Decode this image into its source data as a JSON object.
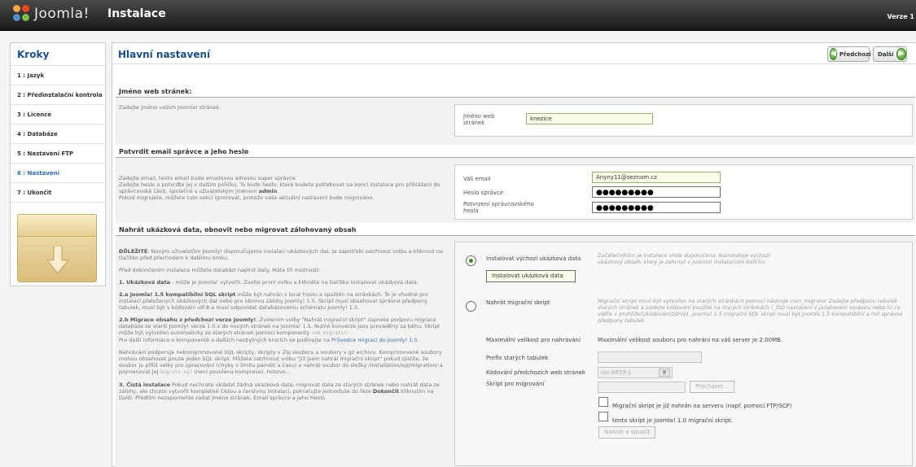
{
  "header": {
    "logo_text": "Joomla!",
    "title": "Instalace",
    "version": "Verze 1"
  },
  "sidebar": {
    "title": "Kroky",
    "steps": [
      "1 : Jazyk",
      "2 : Předinstalační kontrola",
      "3 : Licence",
      "4 : Databáze",
      "5 : Nastavení FTP",
      "6 : Nastavení",
      "7 : Ukončit"
    ],
    "active_step": 5
  },
  "main": {
    "title": "Hlavní nastavení",
    "prev_label": "Předchozí",
    "next_label": "Další"
  },
  "site_name": {
    "section_title": "Jméno web stránek:",
    "help": "Zadejte jméno vašich Joomla! stránek.",
    "label": "Jméno web stránek",
    "value": "knezice"
  },
  "admin": {
    "section_title": "Potvrdit email správce a jeho heslo",
    "help_1": "Zadejte email, tento email bude emailovou adresou super správce.",
    "help_2": "Zadejte heslo a potvrďte jej v dalším políčku. To bude heslo, které budete potřebovat na konci instalace pro přihlášení do správcovské části, společně s uživatelským jménem",
    "help_2_bold": "admin",
    "help_3": "Pokud migrujete, můžete tuto sekci ignorovat, protože vaše aktuální nastavení bude migrováno.",
    "email_label": "Váš email",
    "email_value": "Anyny11@seznam.cz",
    "password_label": "Heslo správce",
    "password_value": "●●●●●●●●●",
    "confirm_label": "Potvrzení správcovského hesla",
    "confirm_value": "●●●●●●●●●"
  },
  "sample": {
    "section_title": "Nahrát ukázková data, obnovit nebo migrovat zálohovaný obsah",
    "p1_bold": "DŮLEŽITÉ",
    "p1": ": Novým uživatelům Joomly! doporučujeme instalaci ukázkových dat. Je zapotřebí zatrhnout volbu a kliknout na tlačítko před přechodem k dalšímu kroku.",
    "p2": "Před dokončením instalace můžete databázi naplnit daty. Máte tři možnosti:",
    "p3_bold": "1. Ukázková data",
    "p3": " - může je Joomla! vytvořit. Zvolte první volbu a klikněte na tlačítko Instalovat ukázková data.",
    "p4_bold": "2.a Joomla! 1.5 kompatibilní SQL skript",
    "p4": " může být nahrán z local hostu a spuštěn na stránkách. To je vhodné pro instalaci přeložených ukázkových dat nebo pro obnovu zálohy Joomly! 1.5. Skript musí obsahovat správné předpony tabulek, musí být v kódování utf-8 a musí odpovídat databázovému schématu Joomly! 1.5.",
    "p5_bold": "2.b Migrace obsahu z předchozí verze Joomly!",
    "p5": ". Zvolením volby \"Nahrát migrační skript\" zapnete podporu migrace databáze ze starší Joomly! verze 1.0.x do nových stránek na Joomla! 1.5. Nutné konverze jsou prováděny za běhu. Skript může být vytvořen automaticky ze starých stránek pomocí komponenty",
    "p5_mono": "com_migrator",
    "p6": "Pro další informace o komponentě a dalších nezbytných krocích se podívejte na",
    "p6_link": "Průvodce migrací do Joomly! 1.5.",
    "p7": "Nahrávání podporuje nekomprimované SQL skripty, skripty v Zip souboru a soubory v gz archivu. Komprimované soubory mohou obsahovat pouze jeden SQL skript. Můžete zatrhnout volbu \"Již jsem nahrál migrační skript\" pokud zjistíte, že soubor je příliš velký pro zpracování (chyby v limitu paměti a času) a nahrát soubor do složky /installation/sql/migration/ a pojmenovat jej",
    "p7_mono": "migrate.sql",
    "p7_end": " (není povolena komprese). Hotovo...",
    "p8_bold": "3. Čistá instalace",
    "p8": " Pokud nechcete vkládat žádná ukázková data, migrovat data ze starých stránek nebo nahrát data ze zálohy, ale chcete vytvořit kompletně čistou a čerstvou instalaci, pokračujte jednoduše do fáze",
    "p8_bold2": "Dokončit",
    "p8_end": " kliknutím na Další. Předtím nezapomeňte zadat Jméno stránek, Email správce a jeho Heslo.",
    "opt1_label": "Instalovat výchozí ukázková data",
    "opt1_desc": "Začátečníkům je instalace vřele doporučena. Nainstaluje výchozí ukázkový obsah, který je zahrnut v Joomla! instalačním balíčku.",
    "opt1_button": "Instalovat ukázková data",
    "opt2_label": "Nahrát migrační skript",
    "opt2_desc": "Migrační skript musí být vytvořen na starých stránkách pomocí nástroje com_migrator Zadejte předponu tabulek starých stránek a zadejte kódování použité na starých stránkách (_ISO nastavení v jazykovém souboru nebo to co vidíte v prohlížeči/kódování/zdroji). Joomla! 1.5 migrační SQL skript musí být Joomla 1.5 kompatibilní a mít správné předpony tabulek.",
    "max_size_label": "Maximální velikost pro nahrávání",
    "max_size_value": "Maximální velikost souboru pro nahrání na váš server je 2.00MB.",
    "prefix_label": "Prefix starých tabulek",
    "encoding_label": "Kódování předchozích web stránek",
    "encoding_value": "iso-8859-1",
    "script_label": "Skript pro migrování",
    "browse_button": "Procházet...",
    "check1_label": "Migrační skript je již nahrán na serveru (např. pomocí FTP/SCP)",
    "check2_label": "tento skript je Joomla! 1.0 migrační skript.",
    "upload_button": "Nahrát a spustit"
  },
  "colors": {
    "accent": "#1a4f8f",
    "active_step": "#2a6fbd",
    "topbar": "#1a1a1a"
  }
}
